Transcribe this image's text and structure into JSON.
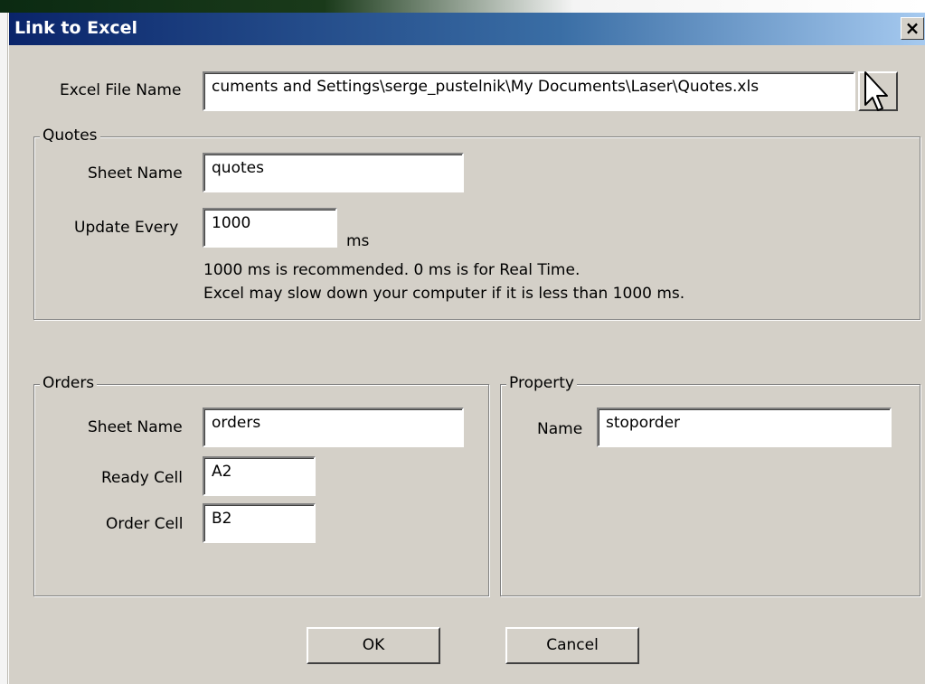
{
  "window": {
    "title": "Link to Excel",
    "close_glyph": "×"
  },
  "excel_file": {
    "label": "Excel File Name",
    "value": "cuments and Settings\\serge_pustelnik\\My Documents\\Laser\\Quotes.xls",
    "browse_icon": "mouse-pointer-icon"
  },
  "quotes": {
    "group_title": "Quotes",
    "sheet_name_label": "Sheet Name",
    "sheet_name_value": "quotes",
    "update_every_label": "Update Every",
    "update_every_value": "1000",
    "unit": "ms",
    "note_line1": "1000 ms is recommended. 0 ms is for Real Time.",
    "note_line2": "Excel may slow down your computer if it is less than 1000 ms."
  },
  "orders": {
    "group_title": "Orders",
    "sheet_name_label": "Sheet Name",
    "sheet_name_value": "orders",
    "ready_cell_label": "Ready Cell",
    "ready_cell_value": "A2",
    "order_cell_label": "Order Cell",
    "order_cell_value": "B2"
  },
  "property": {
    "group_title": "Property",
    "name_label": "Name",
    "name_value": "stoporder"
  },
  "buttons": {
    "ok": "OK",
    "cancel": "Cancel"
  }
}
